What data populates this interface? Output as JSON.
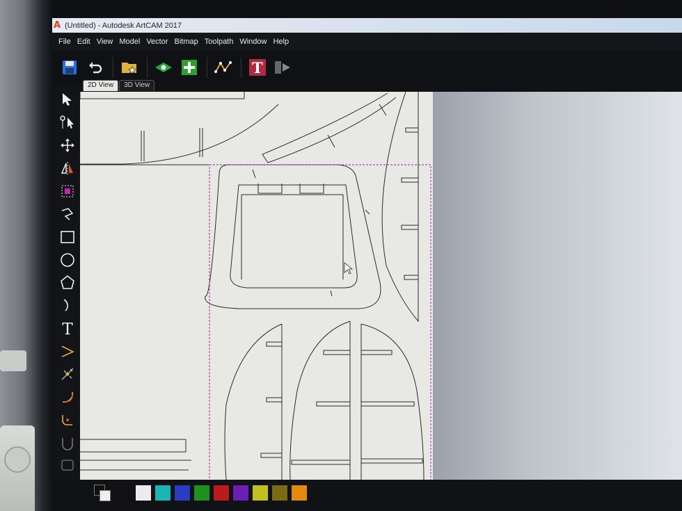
{
  "window": {
    "title": "(Untitled) - Autodesk ArtCAM 2017",
    "logo_letter": "A"
  },
  "menu": [
    "File",
    "Edit",
    "View",
    "Model",
    "Vector",
    "Bitmap",
    "Toolpath",
    "Window",
    "Help"
  ],
  "tabs": [
    {
      "label": "2D View",
      "active": true
    },
    {
      "label": "3D View",
      "active": false
    }
  ],
  "toolbar_icons": [
    "save-icon",
    "undo-icon",
    "open-folder-icon",
    "view-layer-icon",
    "add-icon",
    "node-editing-icon",
    "text-tool-icon",
    "bitmap-to-vector-icon"
  ],
  "left_tools": [
    "select-arrow-icon",
    "node-edit-icon",
    "transform-icon",
    "mirror-icon",
    "bitmap-select-icon",
    "polyline-icon",
    "rectangle-icon",
    "circle-icon",
    "polygon-icon",
    "arc-icon",
    "text-icon",
    "bezier-icon",
    "snap-icon",
    "offset-icon",
    "fillet-icon",
    "join-icon",
    "trim-icon"
  ],
  "text_tool_glyph": "T",
  "palette": {
    "colors": [
      "#111111",
      "#ececec",
      "#1ab5b5",
      "#2a3cc4",
      "#1f8f1f",
      "#b81c1c",
      "#6a1fb0",
      "#c2c020",
      "#7a6a12",
      "#e08a10"
    ]
  },
  "colors": {
    "sheet": "#e8e8e5",
    "vector_stroke": "#2a2a2a",
    "selection_box": "#a020a0"
  }
}
